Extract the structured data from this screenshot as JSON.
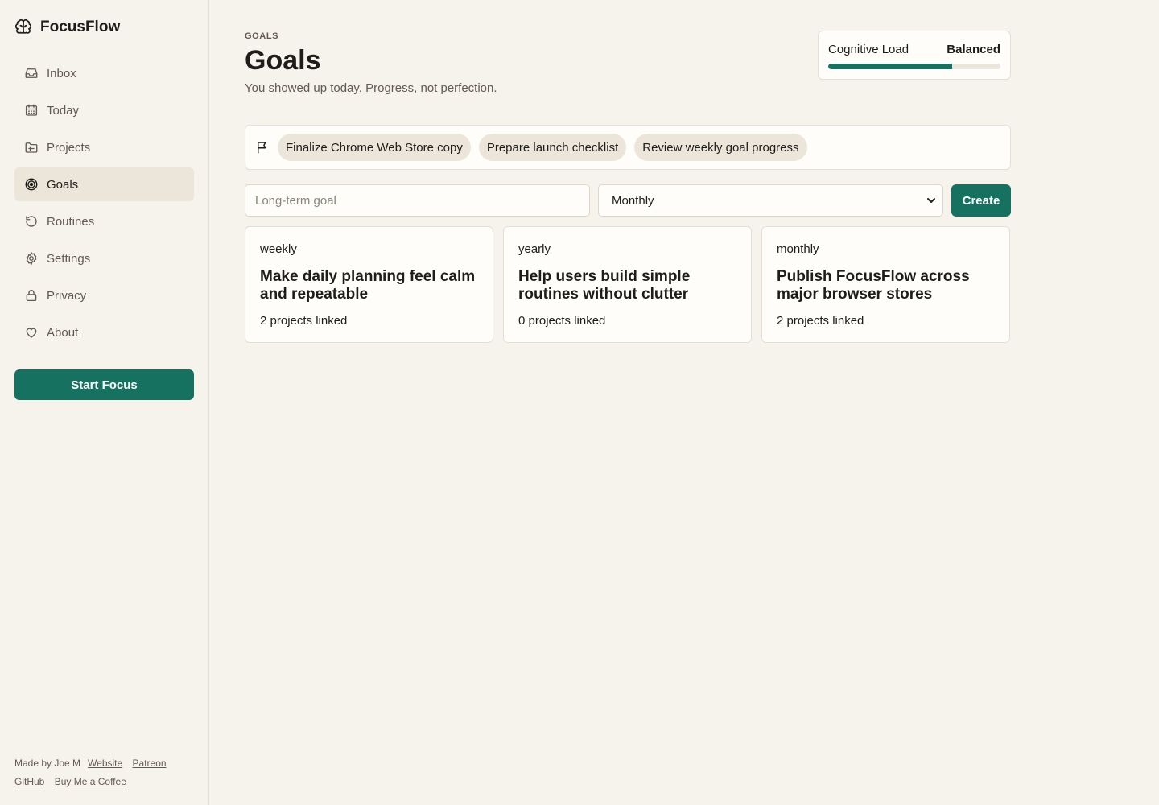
{
  "app": {
    "name": "FocusFlow"
  },
  "sidebar": {
    "items": [
      {
        "label": "Inbox",
        "icon": "inbox-icon"
      },
      {
        "label": "Today",
        "icon": "calendar-icon"
      },
      {
        "label": "Projects",
        "icon": "folder-icon"
      },
      {
        "label": "Goals",
        "icon": "target-icon",
        "active": true
      },
      {
        "label": "Routines",
        "icon": "refresh-icon"
      },
      {
        "label": "Settings",
        "icon": "gear-icon"
      },
      {
        "label": "Privacy",
        "icon": "lock-icon"
      },
      {
        "label": "About",
        "icon": "heart-icon"
      }
    ],
    "start_focus_label": "Start Focus",
    "footer": {
      "made_by": "Made by Joe M",
      "links": [
        "Website",
        "Patreon",
        "GitHub",
        "Buy Me a Coffee"
      ]
    }
  },
  "header": {
    "eyebrow": "GOALS",
    "title": "Goals",
    "subtitle": "You showed up today. Progress, not perfection."
  },
  "cognitive_load": {
    "label": "Cognitive Load",
    "value": "Balanced",
    "level": 0.72
  },
  "focus_chips": [
    "Finalize Chrome Web Store copy",
    "Prepare launch checklist",
    "Review weekly goal progress"
  ],
  "form": {
    "goal_placeholder": "Long-term goal",
    "goal_value": "",
    "period_selected": "Monthly",
    "create_label": "Create"
  },
  "goals": [
    {
      "period": "weekly",
      "title": "Make daily planning feel calm and repeatable",
      "meta": "2 projects linked"
    },
    {
      "period": "yearly",
      "title": "Help users build simple routines without clutter",
      "meta": "0 projects linked"
    },
    {
      "period": "monthly",
      "title": "Publish FocusFlow across major browser stores",
      "meta": "2 projects linked"
    }
  ],
  "colors": {
    "accent": "#167160",
    "background": "#f6f2ec",
    "card": "#fffdf9",
    "active_nav": "#ece6da"
  }
}
